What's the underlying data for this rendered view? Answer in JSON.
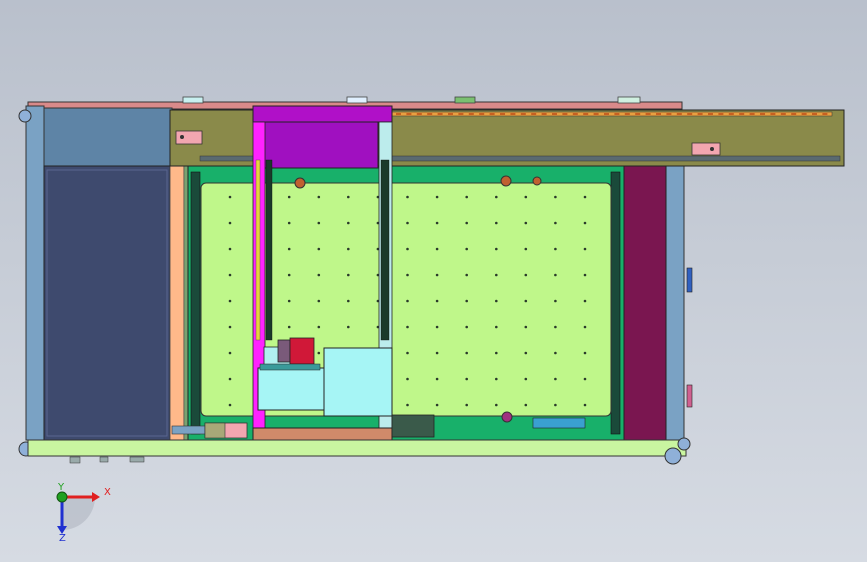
{
  "viewport": {
    "view_orientation": "top",
    "background": [
      "#b9c0cc",
      "#d6dbe3"
    ]
  },
  "triad": {
    "x_label": "X",
    "y_label": "Y",
    "z_label": "Z",
    "x_color": "#e02020",
    "y_color": "#20a020",
    "z_color": "#2030d0"
  },
  "colors": {
    "frame_top": "#d98a8a",
    "left_panel": "#3e4a6e",
    "left_upper_panel": "#5e84a6",
    "beam": "#8a8a4a",
    "carriage": "#b010c8",
    "magenta_rail": "#ff22ff",
    "bed_base": "#18b06a",
    "bed_plate": "#bff78a",
    "right_panel": "#7a1650",
    "bottom_frame": "#c9f5a0",
    "head_block": "#a6f5f5",
    "motor_red": "#d01838",
    "peach_strip": "#ffb98a",
    "bottom_bar": "#d08a6a"
  },
  "bed_holes": {
    "rows": 9,
    "cols": 13
  }
}
